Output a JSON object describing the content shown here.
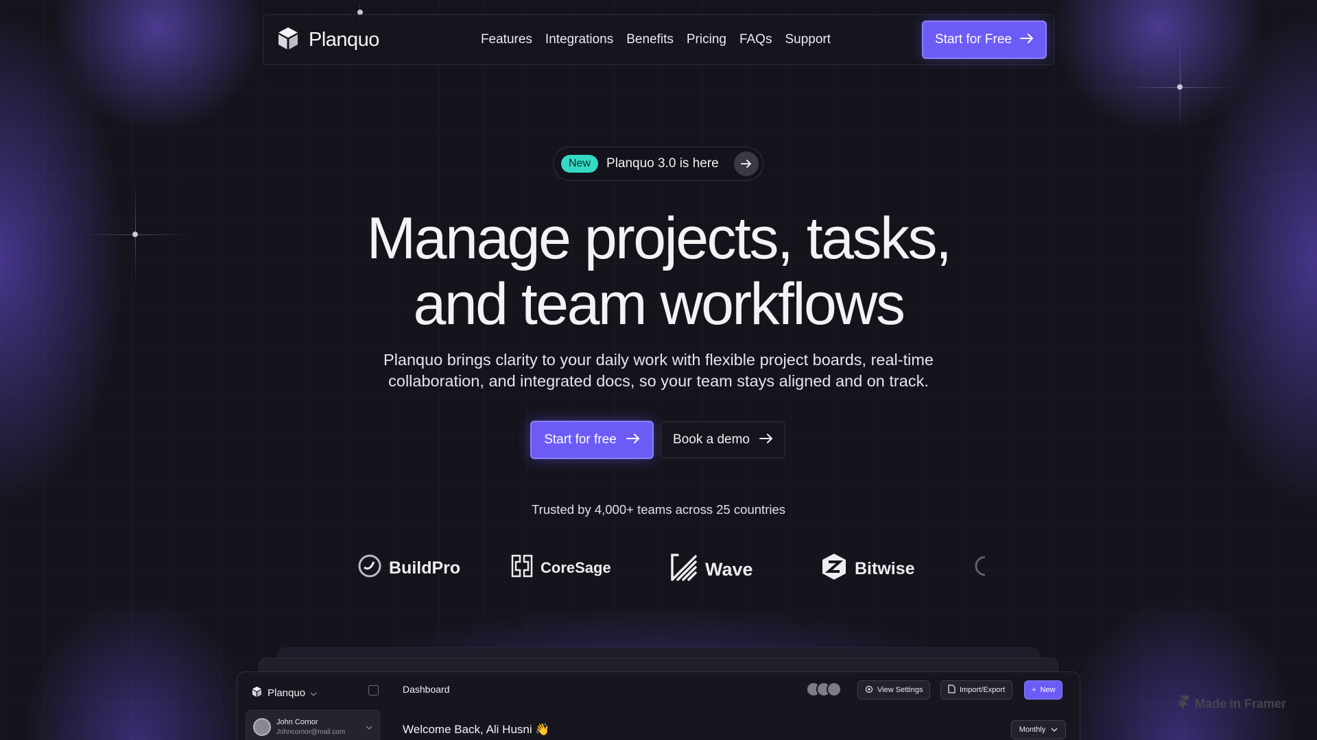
{
  "nav": {
    "logo_name": "Planquo",
    "links": [
      "Features",
      "Integrations",
      "Benefits",
      "Pricing",
      "FAQs",
      "Support"
    ],
    "cta_label": "Start for Free"
  },
  "badge": {
    "tag": "New",
    "text": "Planquo 3.0 is here"
  },
  "hero": {
    "title_line1": "Manage projects, tasks,",
    "title_line2": "and team workflows",
    "subtitle_line1": "Planquo brings clarity to your daily work with flexible project boards, real-time",
    "subtitle_line2": "collaboration, and integrated docs, so your team stays aligned and on track.",
    "primary_cta": "Start for free",
    "secondary_cta": "Book a demo"
  },
  "trusted": "Trusted by 4,000+ teams across 25 countries",
  "brands": [
    "BuildPro",
    "CoreSage",
    "Wave",
    "Bitwise"
  ],
  "dashboard": {
    "app_name": "Planquo",
    "user_name": "John Cornor",
    "user_email": "Johncornor@mail.com",
    "page_title": "Dashboard",
    "welcome": "Welcome Back, Ali Husni 👋",
    "view_settings": "View Settings",
    "import_export": "Import/Export",
    "new_label": "New",
    "period": "Monthly"
  },
  "framer_badge": "Made in Framer",
  "colors": {
    "accent": "#6c5cf5",
    "badge_teal": "#34d9c3",
    "background": "#15141c"
  }
}
